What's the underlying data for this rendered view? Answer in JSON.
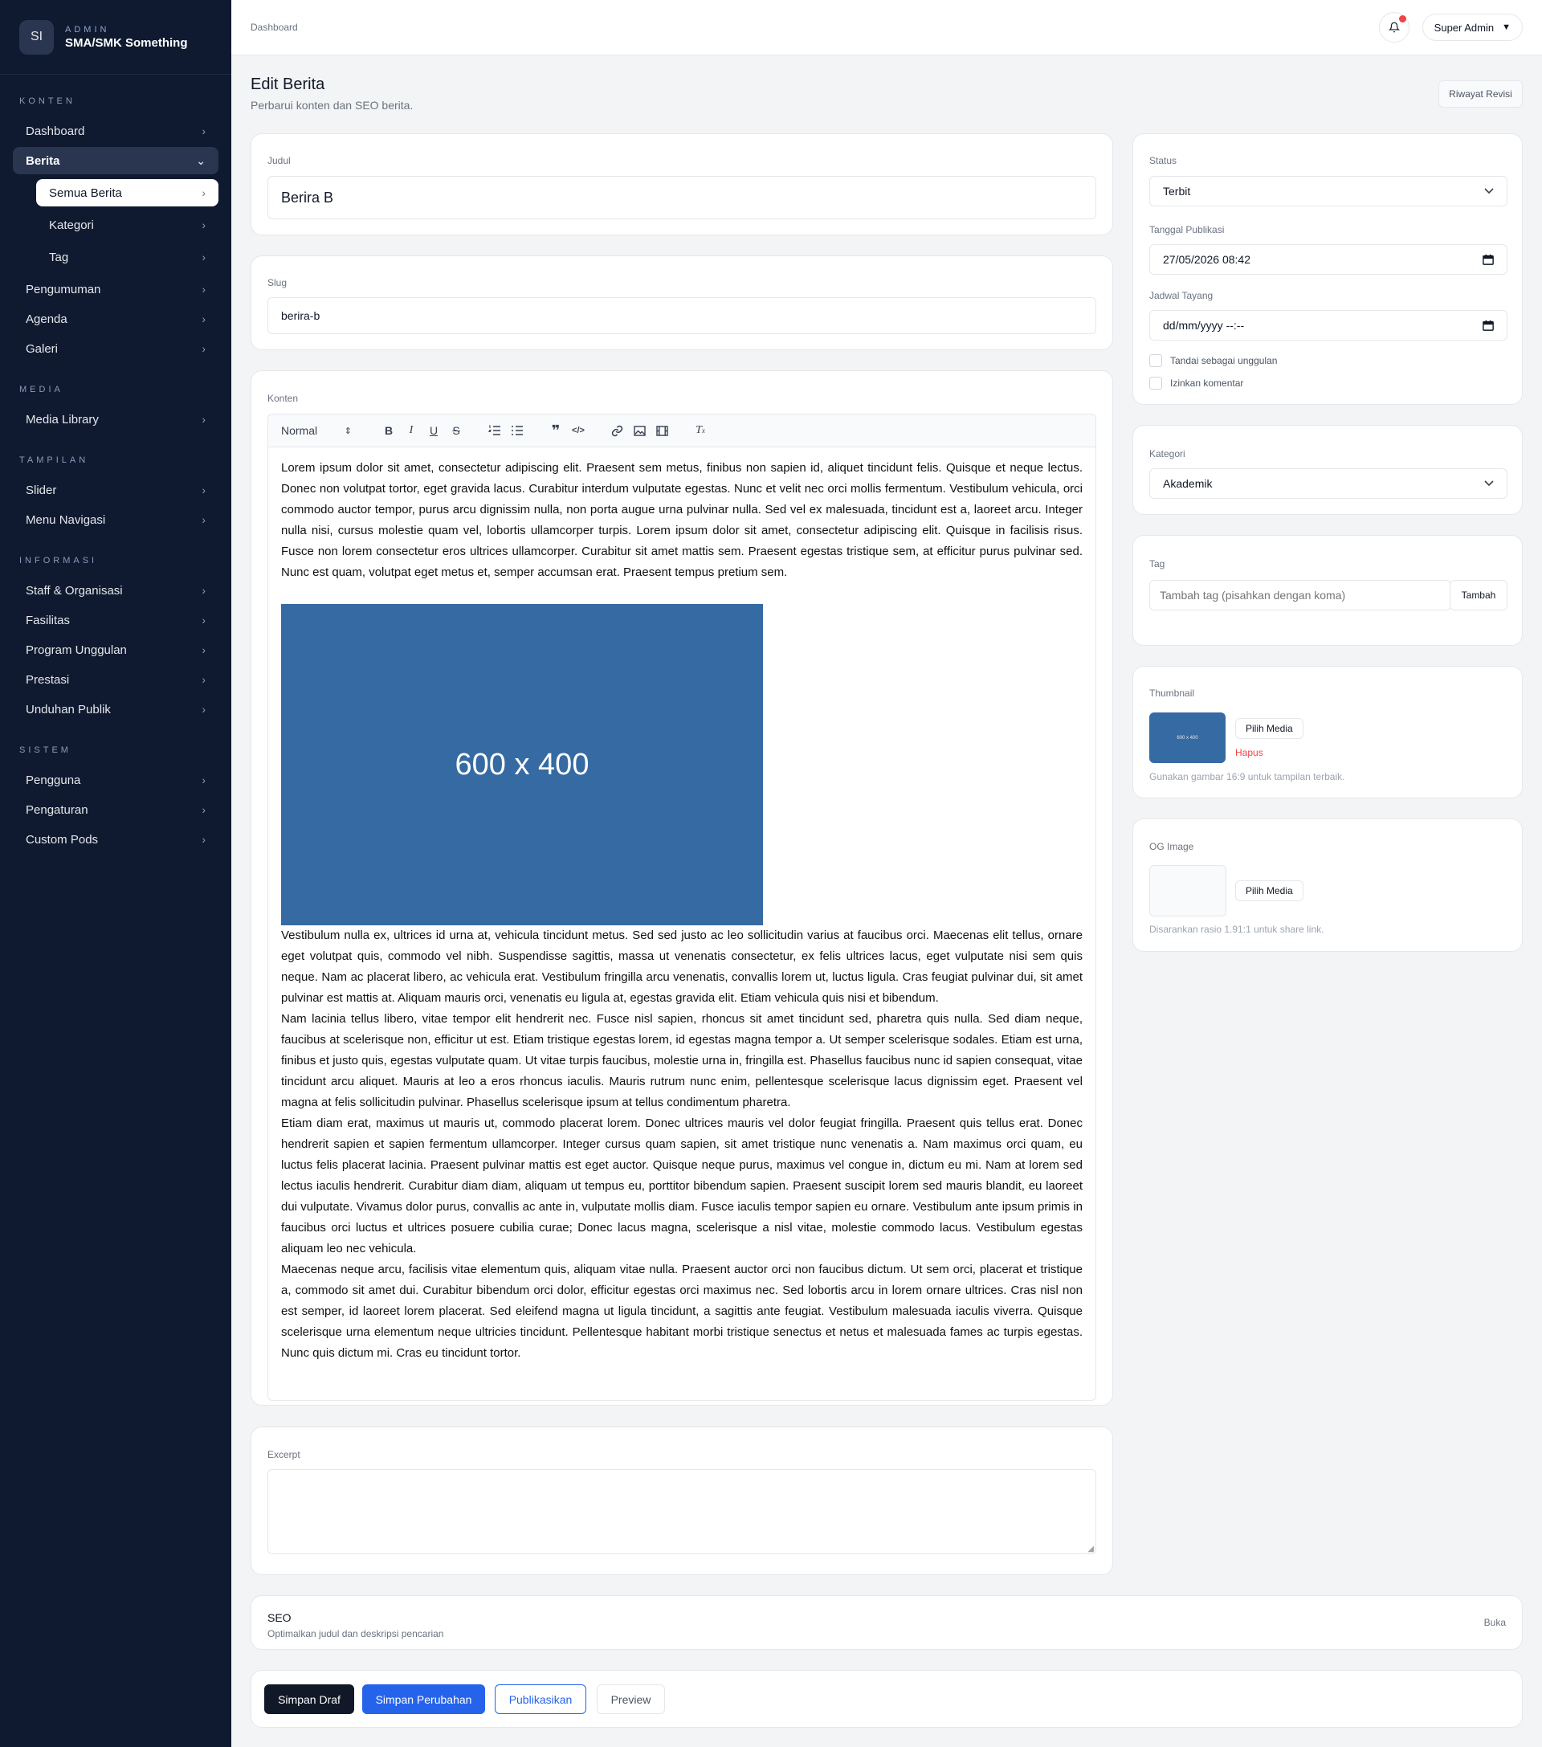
{
  "brand": {
    "logo": "SI",
    "sub": "ADMIN",
    "title": "SMA/SMK Something"
  },
  "sidebar": {
    "konten_label": "KONTEN",
    "dashboard": "Dashboard",
    "berita": "Berita",
    "semua_berita": "Semua Berita",
    "kategori": "Kategori",
    "tag": "Tag",
    "pengumuman": "Pengumuman",
    "agenda": "Agenda",
    "galeri": "Galeri",
    "media_label": "MEDIA",
    "media_library": "Media Library",
    "tampilan_label": "TAMPILAN",
    "slider": "Slider",
    "menu_navigasi": "Menu Navigasi",
    "informasi_label": "INFORMASI",
    "staff": "Staff & Organisasi",
    "fasilitas": "Fasilitas",
    "program": "Program Unggulan",
    "prestasi": "Prestasi",
    "unduhan": "Unduhan Publik",
    "sistem_label": "SISTEM",
    "pengguna": "Pengguna",
    "pengaturan": "Pengaturan",
    "custom_pods": "Custom Pods"
  },
  "topbar": {
    "breadcrumb": "Dashboard",
    "user": "Super Admin",
    "user_caret": "▼"
  },
  "page": {
    "title": "Edit Berita",
    "subtitle": "Perbarui konten dan SEO berita.",
    "revision_button": "Riwayat Revisi"
  },
  "form": {
    "judul_label": "Judul",
    "judul_value": "Berira B",
    "slug_label": "Slug",
    "slug_value": "berira-b",
    "konten_label": "Konten",
    "toolbar_format": "Normal",
    "content_p1": "Lorem ipsum dolor sit amet, consectetur adipiscing elit. Praesent sem metus, finibus non sapien id, aliquet tincidunt felis. Quisque et neque lectus. Donec non volutpat tortor, eget gravida lacus. Curabitur interdum vulputate egestas. Nunc et velit nec orci mollis fermentum. Vestibulum vehicula, orci commodo auctor tempor, purus arcu dignissim nulla, non porta augue urna pulvinar nulla. Sed vel ex malesuada, tincidunt est a, laoreet arcu. Integer nulla nisi, cursus molestie quam vel, lobortis ullamcorper turpis. Lorem ipsum dolor sit amet, consectetur adipiscing elit. Quisque in facilisis risus. Fusce non lorem consectetur eros ultrices ullamcorper. Curabitur sit amet mattis sem. Praesent egestas tristique sem, at efficitur purus pulvinar sed. Nunc est quam, volutpat eget metus et, semper accumsan erat. Praesent tempus pretium sem.",
    "image_label": "600 x 400",
    "content_p2": "Vestibulum nulla ex, ultrices id urna at, vehicula tincidunt metus. Sed sed justo ac leo sollicitudin varius at faucibus orci. Maecenas elit tellus, ornare eget volutpat quis, commodo vel nibh. Suspendisse sagittis, massa ut venenatis consectetur, ex felis ultrices lacus, eget vulputate nisi sem quis neque. Nam ac placerat libero, ac vehicula erat. Vestibulum fringilla arcu venenatis, convallis lorem ut, luctus ligula. Cras feugiat pulvinar dui, sit amet pulvinar est mattis at. Aliquam mauris orci, venenatis eu ligula at, egestas gravida elit. Etiam vehicula quis nisi et bibendum.",
    "content_p3": "Nam lacinia tellus libero, vitae tempor elit hendrerit nec. Fusce nisl sapien, rhoncus sit amet tincidunt sed, pharetra quis nulla. Sed diam neque, faucibus at scelerisque non, efficitur ut est. Etiam tristique egestas lorem, id egestas magna tempor a. Ut semper scelerisque sodales. Etiam est urna, finibus et justo quis, egestas vulputate quam. Ut vitae turpis faucibus, molestie urna in, fringilla est. Phasellus faucibus nunc id sapien consequat, vitae tincidunt arcu aliquet. Mauris at leo a eros rhoncus iaculis. Mauris rutrum nunc enim, pellentesque scelerisque lacus dignissim eget. Praesent vel magna at felis sollicitudin pulvinar. Phasellus scelerisque ipsum at tellus condimentum pharetra.",
    "content_p4": "Etiam diam erat, maximus ut mauris ut, commodo placerat lorem. Donec ultrices mauris vel dolor feugiat fringilla. Praesent quis tellus erat. Donec hendrerit sapien et sapien fermentum ullamcorper. Integer cursus quam sapien, sit amet tristique nunc venenatis a. Nam maximus orci quam, eu luctus felis placerat lacinia. Praesent pulvinar mattis est eget auctor. Quisque neque purus, maximus vel congue in, dictum eu mi. Nam at lorem sed lectus iaculis hendrerit. Curabitur diam diam, aliquam ut tempus eu, porttitor bibendum sapien. Praesent suscipit lorem sed mauris blandit, eu laoreet dui vulputate. Vivamus dolor purus, convallis ac ante in, vulputate mollis diam. Fusce iaculis tempor sapien eu ornare. Vestibulum ante ipsum primis in faucibus orci luctus et ultrices posuere cubilia curae; Donec lacus magna, scelerisque a nisl vitae, molestie commodo lacus. Vestibulum egestas aliquam leo nec vehicula.",
    "content_p5": "Maecenas neque arcu, facilisis vitae elementum quis, aliquam vitae nulla. Praesent auctor orci non faucibus dictum. Ut sem orci, placerat et tristique a, commodo sit amet dui. Curabitur bibendum orci dolor, efficitur egestas orci maximus nec. Sed lobortis arcu in lorem ornare ultrices. Cras nisl non est semper, id laoreet lorem placerat. Sed eleifend magna ut ligula tincidunt, a sagittis ante feugiat. Vestibulum malesuada iaculis viverra. Quisque scelerisque urna elementum neque ultricies tincidunt. Pellentesque habitant morbi tristique senectus et netus et malesuada fames ac turpis egestas. Nunc quis dictum mi. Cras eu tincidunt tortor.",
    "excerpt_label": "Excerpt",
    "seo_title": "SEO",
    "seo_sub": "Optimalkan judul dan deskripsi pencarian",
    "seo_toggle": "Buka"
  },
  "side": {
    "status_label": "Status",
    "status_value": "Terbit",
    "pub_label": "Tanggal Publikasi",
    "pub_value": "27/05/2026 08:42",
    "jadwal_label": "Jadwal Tayang",
    "jadwal_value": "dd/mm/yyyy --:--",
    "unggulan_label": "Tandai sebagai unggulan",
    "komentar_label": "Izinkan komentar",
    "kategori_label": "Kategori",
    "kategori_value": "Akademik",
    "tag_label": "Tag",
    "tag_placeholder": "Tambah tag (pisahkan dengan koma)",
    "tag_add": "Tambah",
    "thumb_label": "Thumbnail",
    "thumb_img_text": "600 x 400",
    "thumb_pick": "Pilih Media",
    "thumb_remove": "Hapus",
    "thumb_hint": "Gunakan gambar 16:9 untuk tampilan terbaik.",
    "og_label": "OG Image",
    "og_pick": "Pilih Media",
    "og_hint": "Disarankan rasio 1.91:1 untuk share link."
  },
  "actions": {
    "draft": "Simpan Draf",
    "save": "Simpan Perubahan",
    "publish": "Publikasikan",
    "preview": "Preview"
  },
  "colors": {
    "sidebar_bg": "#0f1a30",
    "primary": "#2563eb",
    "dark_button": "#111827",
    "danger": "#ef4444",
    "placeholder_image": "#366aa2"
  }
}
